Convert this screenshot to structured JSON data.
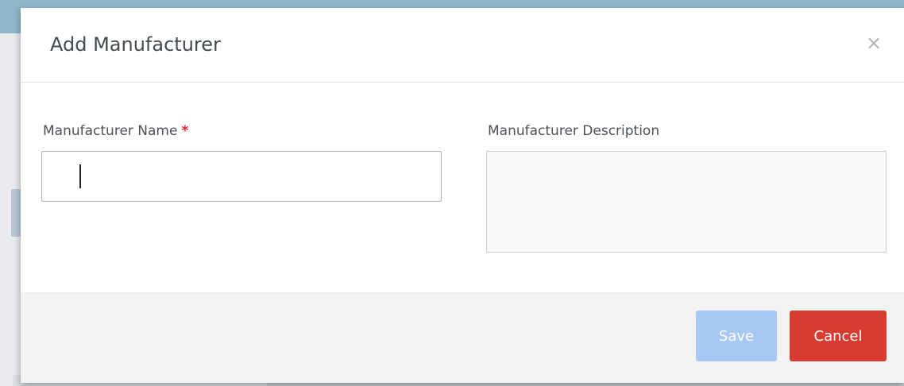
{
  "modal": {
    "title": "Add Manufacturer",
    "close_glyph": "×",
    "close_icon": "close-icon"
  },
  "form": {
    "name_label": "Manufacturer Name",
    "required_mark": "*",
    "name_value": "",
    "description_label": "Manufacturer Description",
    "description_value": ""
  },
  "footer": {
    "save_label": "Save",
    "cancel_label": "Cancel"
  },
  "colors": {
    "required": "#e3262b",
    "save_disabled": "#a6c8f2",
    "cancel": "#d83b30",
    "footer_bg": "#f2f2f2"
  }
}
